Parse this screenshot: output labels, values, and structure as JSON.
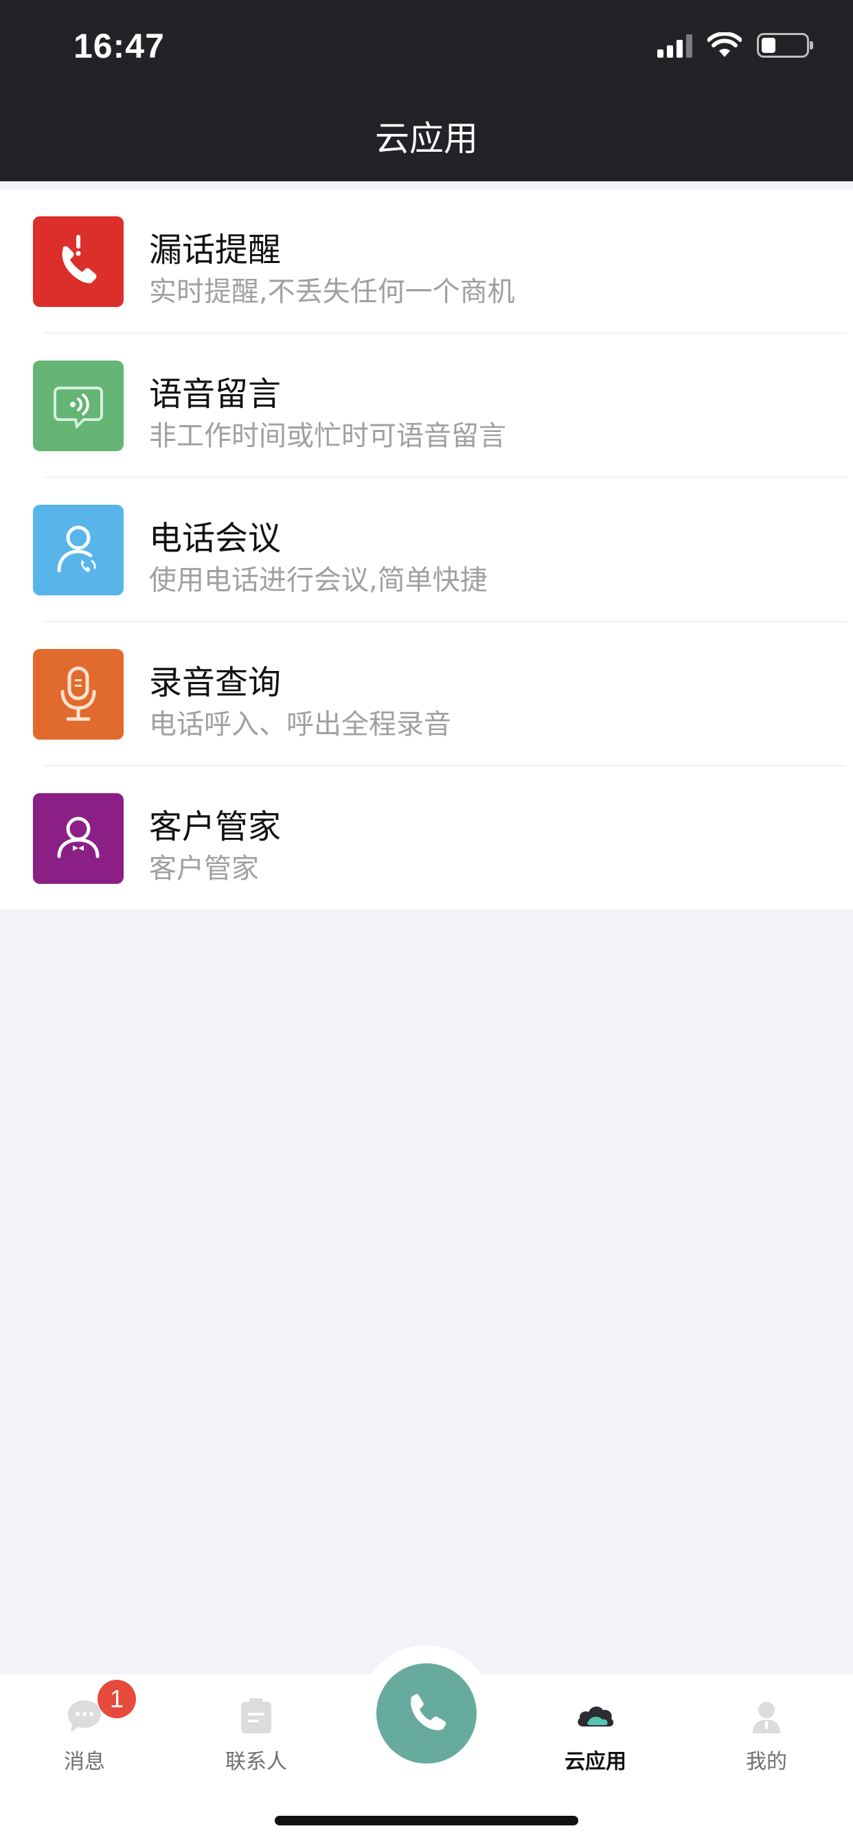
{
  "status_bar": {
    "time": "16:47"
  },
  "header": {
    "title": "云应用"
  },
  "apps": [
    {
      "title": "漏话提醒",
      "subtitle": "实时提醒,不丢失任何一个商机",
      "icon": "missed-call-icon",
      "color": "#dc2e2b"
    },
    {
      "title": "语音留言",
      "subtitle": "非工作时间或忙时可语音留言",
      "icon": "voice-message-icon",
      "color": "#65b574"
    },
    {
      "title": "电话会议",
      "subtitle": "使用电话进行会议,简单快捷",
      "icon": "conference-call-icon",
      "color": "#57b5ea"
    },
    {
      "title": "录音查询",
      "subtitle": "电话呼入、呼出全程录音",
      "icon": "microphone-icon",
      "color": "#e16b2c"
    },
    {
      "title": "客户管家",
      "subtitle": "客户管家",
      "icon": "customer-icon",
      "color": "#8b1f86"
    }
  ],
  "tabbar": {
    "messages": {
      "label": "消息",
      "badge": "1"
    },
    "contacts": {
      "label": "联系人"
    },
    "cloud_apps": {
      "label": "云应用"
    },
    "mine": {
      "label": "我的"
    }
  },
  "colors": {
    "header_bg": "#222326",
    "call_button": "#66ab9e",
    "badge": "#e64a3b"
  }
}
